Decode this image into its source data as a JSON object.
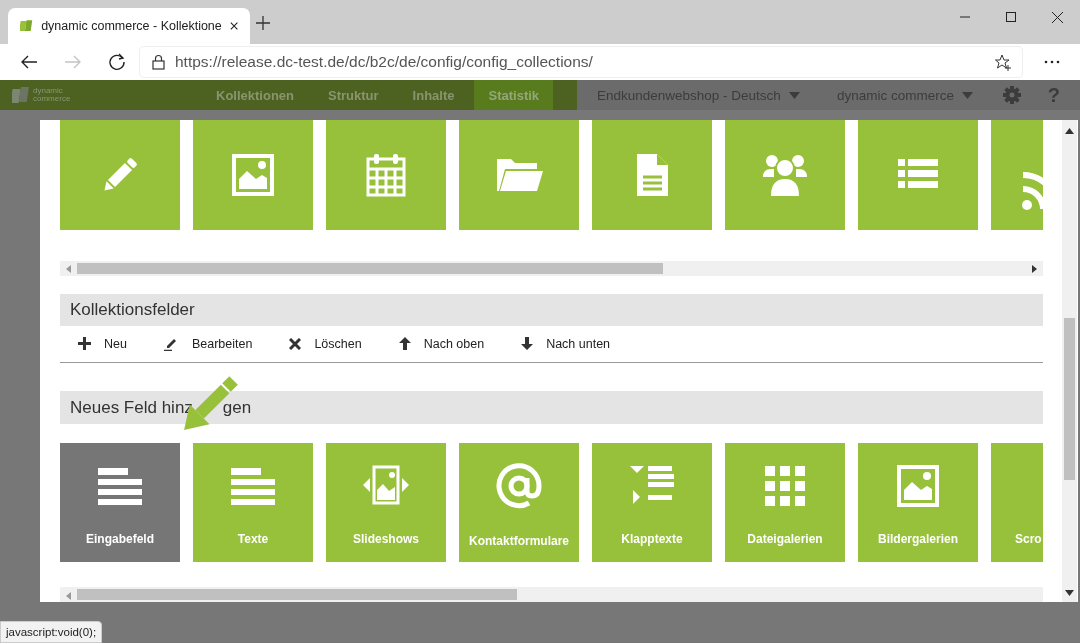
{
  "browser": {
    "tab": {
      "title": "dynamic commerce - Kollektione",
      "selected": true
    },
    "url": "https://release.dc-test.de/dc/b2c/de/config/config_collections/",
    "forward_disabled": true
  },
  "navbar": {
    "logo": "dynamic commerce",
    "items": [
      {
        "label": "Kollektionen",
        "selected": false
      },
      {
        "label": "Struktur",
        "selected": false
      },
      {
        "label": "Inhalte",
        "selected": false
      },
      {
        "label": "Statistik",
        "selected": true
      }
    ],
    "dropdowns": [
      "Endkundenwebshop - Deutsch",
      "dynamic commerce"
    ],
    "help": "?"
  },
  "collection_fields": {
    "title": "Kollektionsfelder",
    "actions": [
      "Neu",
      "Bearbeiten",
      "Löschen",
      "Nach oben",
      "Nach unten"
    ]
  },
  "new_field": {
    "title_parts": [
      "Neues Feld hinz",
      "gen"
    ],
    "tiles": [
      {
        "label": "Eingabefeld",
        "hovered": true
      },
      {
        "label": "Texte",
        "hovered": false
      },
      {
        "label": "Slideshows",
        "hovered": false
      },
      {
        "label": "Kontaktformulare",
        "hovered": false
      },
      {
        "label": "Klapptexte",
        "hovered": false
      },
      {
        "label": "Dateigalerien",
        "hovered": false
      },
      {
        "label": "Bildergalerien",
        "hovered": false
      },
      {
        "label": "Scro",
        "hovered": false
      }
    ]
  },
  "status_text": "javascript:void(0);"
}
